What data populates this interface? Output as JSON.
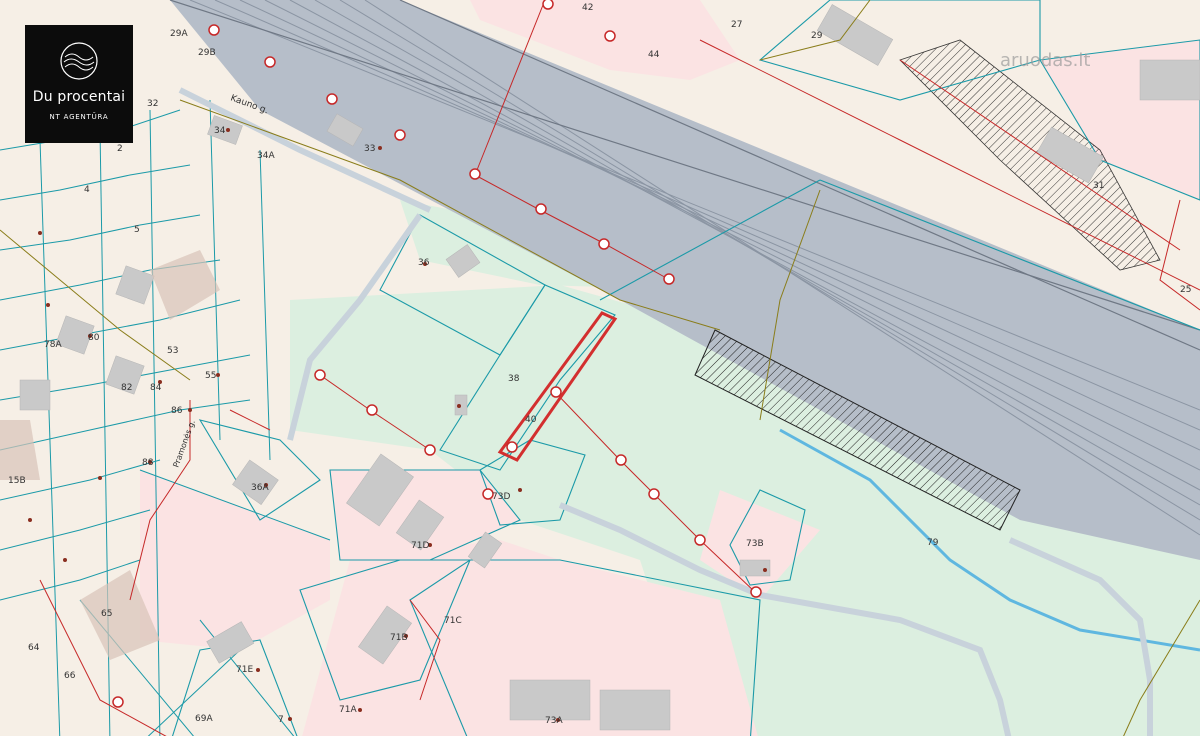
{
  "logo": {
    "name": "Du procentai",
    "subtitle": "NT AGENTŪRA"
  },
  "watermark": "aruodas.lt",
  "street_label": "Kauno g.",
  "street_label2": "Pramonės g.",
  "parcel_labels": [
    "29A",
    "29B",
    "32",
    "34",
    "2",
    "4",
    "5",
    "34A",
    "33",
    "36",
    "38",
    "40",
    "36A",
    "73D",
    "71D",
    "71C",
    "71B",
    "71E",
    "71A",
    "73A",
    "73B",
    "79",
    "80",
    "78A",
    "82",
    "84",
    "86",
    "88",
    "53",
    "55",
    "15B",
    "44",
    "42",
    "25",
    "27",
    "29",
    "31",
    "65",
    "66",
    "64",
    "69A",
    "7"
  ],
  "colors": {
    "base": "#f6efe6",
    "greenZone": "#dcefe0",
    "pinkZone": "#fbe3e3",
    "parcelLine": "#1b9aa8",
    "utilityRed": "#c62828",
    "railGray": "#a9b3bf",
    "subjectParcel": "#d32f2f",
    "water": "#5fb7e0"
  }
}
